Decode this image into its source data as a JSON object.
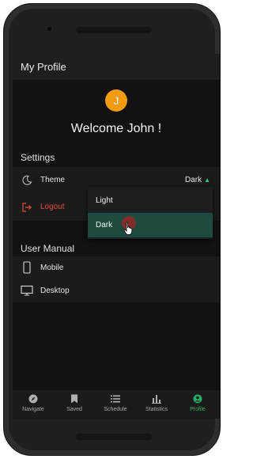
{
  "app": {
    "title": "My Profile"
  },
  "profile": {
    "avatar_initial": "J",
    "welcome": "Welcome John !"
  },
  "settings": {
    "heading": "Settings",
    "theme_label": "Theme",
    "theme_value": "Dark",
    "logout_label": "Logout",
    "theme_options": [
      "Light",
      "Dark"
    ],
    "selected_option": "Dark"
  },
  "user_manual": {
    "heading": "User Manual",
    "mobile_label": "Mobile",
    "desktop_label": "Desktop"
  },
  "nav": {
    "items": [
      {
        "label": "Navigate",
        "icon": "compass-icon"
      },
      {
        "label": "Saved",
        "icon": "bookmark-icon"
      },
      {
        "label": "Schedule",
        "icon": "list-icon"
      },
      {
        "label": "Statistics",
        "icon": "bar-chart-icon"
      },
      {
        "label": "Profile",
        "icon": "profile-icon"
      }
    ],
    "active": "Profile"
  },
  "colors": {
    "accent": "#27ae60",
    "avatar": "#f39c12",
    "logout": "#e74c3c",
    "selected_bg": "#1f4a40"
  }
}
